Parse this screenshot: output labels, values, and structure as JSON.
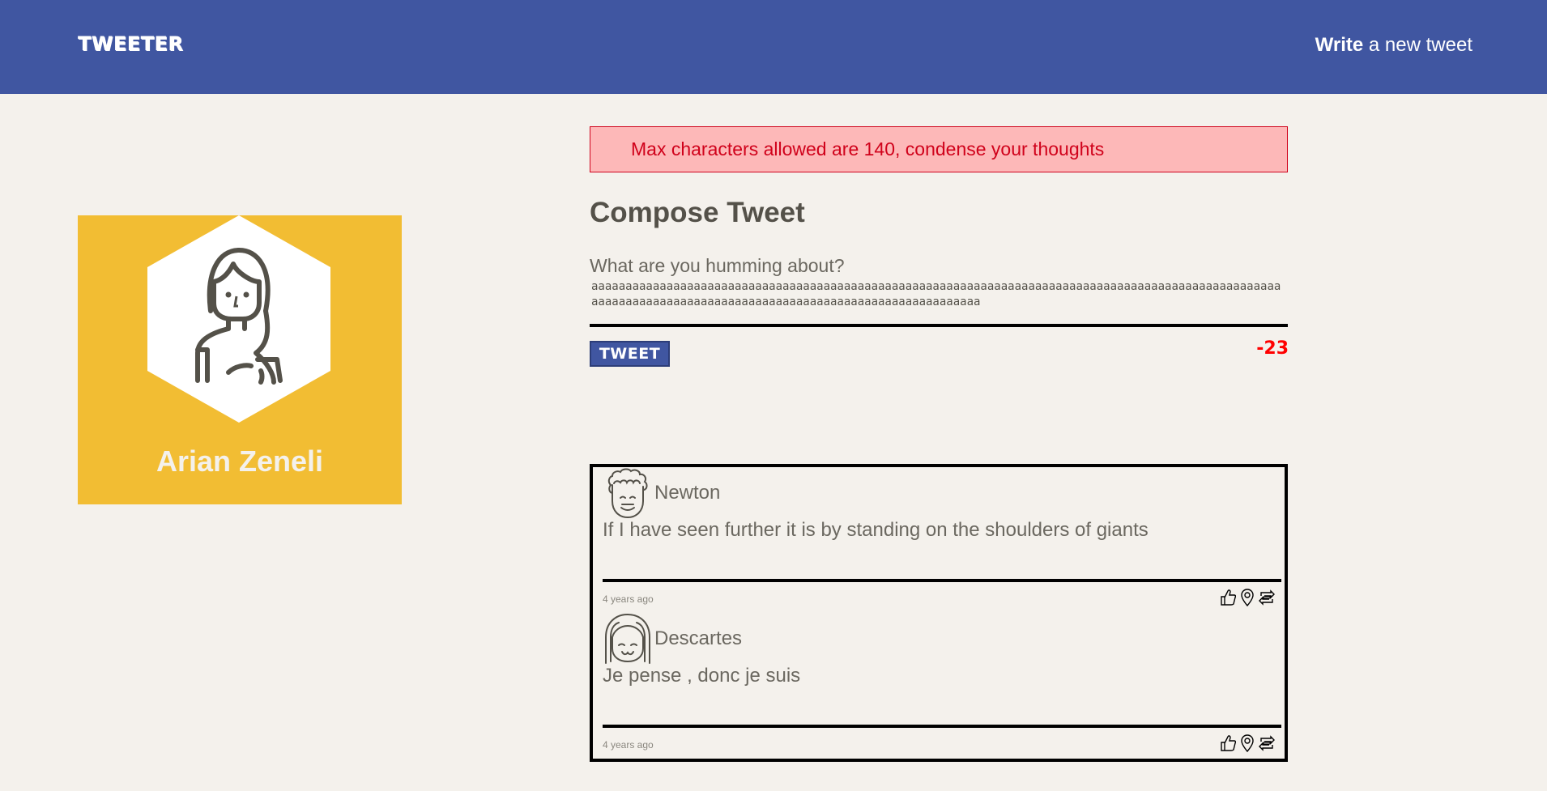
{
  "navbar": {
    "brand": "TWEETER",
    "write_bold": "Write",
    "write_rest": " a new tweet"
  },
  "profile": {
    "name": "Arian Zeneli"
  },
  "compose": {
    "error": "Max characters allowed are 140, condense your thoughts",
    "title": "Compose Tweet",
    "prompt": "What are you humming about?",
    "text": "aaaaaaaaaaaaaaaaaaaaaaaaaaaaaaaaaaaaaaaaaaaaaaaaaaaaaaaaaaaaaaaaaaaaaaaaaaaaaaaaaaaaaaaaaaaaaaaaaaaaaaaaaaaaaaaaaaaaaaaaaaaaaaaaaaaaaaaaaaaaaaaaaaaaaaaaaaaaaa",
    "button": "TWEET",
    "counter": "-23"
  },
  "tweets": [
    {
      "handle": "Newton",
      "content": "If I have seen further it is by standing on the shoulders of giants",
      "time": "4 years ago"
    },
    {
      "handle": "Descartes",
      "content": "Je pense , donc je suis",
      "time": "4 years ago"
    }
  ],
  "colors": {
    "navbar": "#4056a1",
    "profile": "#f2bd33",
    "background": "#f4f1ec",
    "error": "#d0021b",
    "counter": "#ff0000"
  },
  "icons": [
    "like-icon",
    "location-pin-icon",
    "retweet-icon"
  ]
}
